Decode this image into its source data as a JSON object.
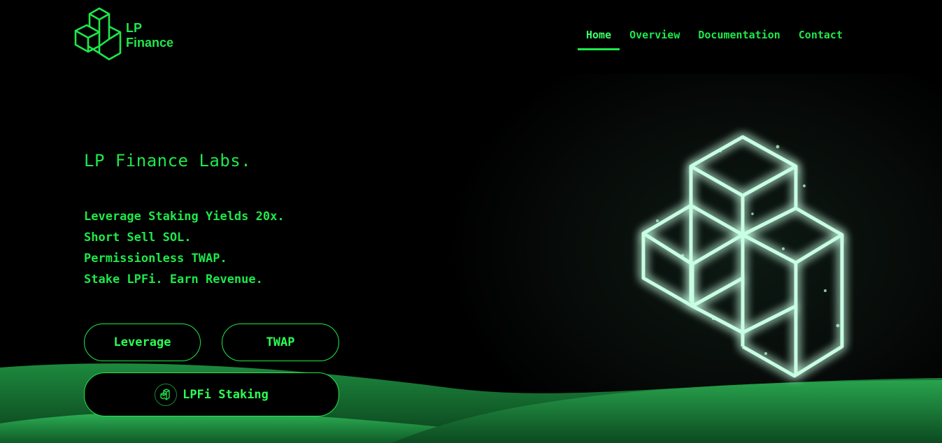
{
  "brand": {
    "line1": "LP",
    "line2": "Finance",
    "logo_icon": "stacked-cubes-icon",
    "color": "#1ee84a"
  },
  "nav": {
    "items": [
      {
        "label": "Home",
        "active": true
      },
      {
        "label": "Overview",
        "active": false
      },
      {
        "label": "Documentation",
        "active": false
      },
      {
        "label": "Contact",
        "active": false
      }
    ]
  },
  "hero": {
    "title": "LP Finance Labs.",
    "taglines": [
      "Leverage Staking Yields 20x.",
      "Short Sell SOL.",
      "Permissionless TWAP.",
      "Stake LPFi. Earn Revenue."
    ],
    "buttons": {
      "leverage": "Leverage",
      "twap": "TWAP",
      "staking": "LPFi Staking",
      "staking_icon": "lpfi-cube-icon"
    },
    "art_icon": "glowing-cubes-icon"
  },
  "colors": {
    "accent": "#1ee84a",
    "background": "#000000",
    "hill": "#1f9a45"
  }
}
